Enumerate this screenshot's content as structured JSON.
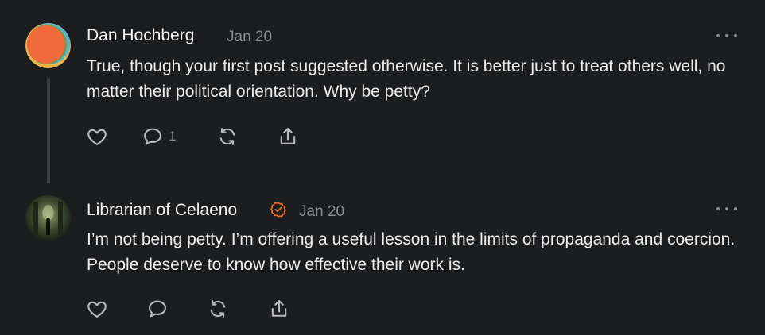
{
  "posts": [
    {
      "author": "Dan Hochberg",
      "date": "Jan 20",
      "text": "True, though your first post suggested otherwise. It is better just to treat others well, no matter their political orientation. Why be petty?",
      "reply_count": "1",
      "verified": false
    },
    {
      "author": "Librarian of Celaeno",
      "date": "Jan 20",
      "text": "I’m not being petty. I’m offering a useful lesson in the limits of propaganda and coercion. People deserve to know how effective their work is.",
      "reply_count": "",
      "verified": true
    }
  ],
  "icons": {
    "like": "heart-icon",
    "reply": "comment-icon",
    "repost": "repost-icon",
    "share": "share-icon",
    "more": "more-options-icon",
    "verified": "verified-badge-icon"
  },
  "colors": {
    "background": "#1c1d1f",
    "verified": "#f26b2a",
    "secondary_text": "#8a8b8e"
  }
}
